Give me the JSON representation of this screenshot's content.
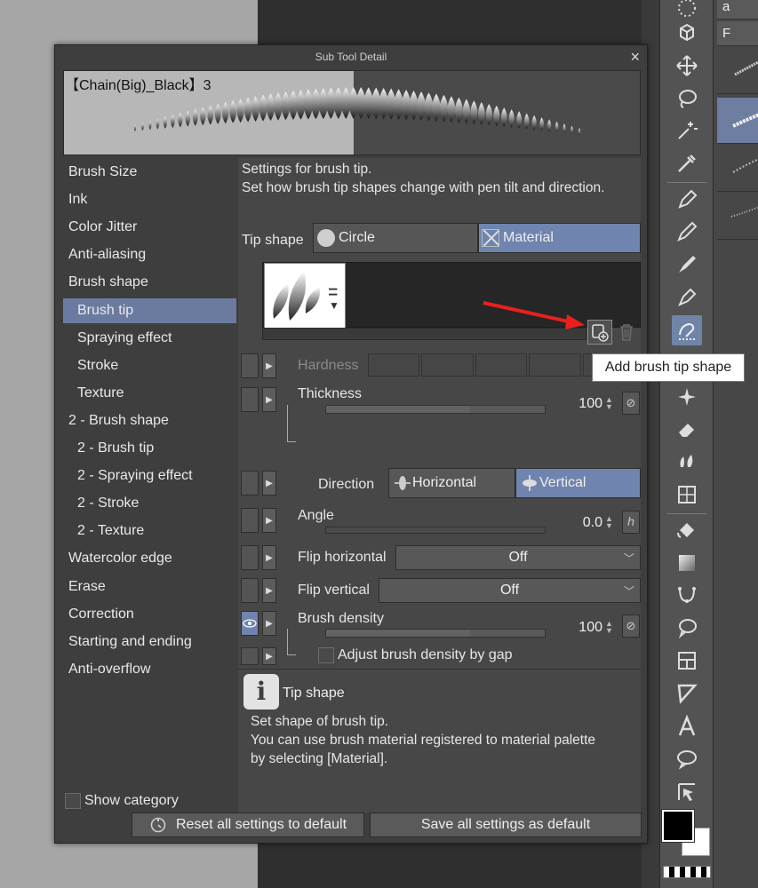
{
  "dialog": {
    "title": "Sub Tool Detail",
    "close_label": "×",
    "preview_name": "【Chain(Big)_Black】3"
  },
  "categories": [
    {
      "label": "Brush Size",
      "sub": false
    },
    {
      "label": "Ink",
      "sub": false
    },
    {
      "label": "Color Jitter",
      "sub": false
    },
    {
      "label": "Anti-aliasing",
      "sub": false
    },
    {
      "label": "Brush shape",
      "sub": false
    },
    {
      "label": "Brush tip",
      "sub": true,
      "active": true
    },
    {
      "label": "Spraying effect",
      "sub": true
    },
    {
      "label": "Stroke",
      "sub": true
    },
    {
      "label": "Texture",
      "sub": true
    },
    {
      "label": "2 - Brush shape",
      "sub": false
    },
    {
      "label": "2 - Brush tip",
      "sub": true
    },
    {
      "label": "2 - Spraying effect",
      "sub": true
    },
    {
      "label": "2 - Stroke",
      "sub": true
    },
    {
      "label": "2 - Texture",
      "sub": true
    },
    {
      "label": "Watercolor edge",
      "sub": false
    },
    {
      "label": "Erase",
      "sub": false
    },
    {
      "label": "Correction",
      "sub": false
    },
    {
      "label": "Starting and ending",
      "sub": false
    },
    {
      "label": "Anti-overflow",
      "sub": false
    }
  ],
  "show_category_label": "Show category",
  "settings": {
    "intro_line1": "Settings for brush tip.",
    "intro_line2": "Set how brush tip shapes change with pen tilt and direction.",
    "tip_shape_label": "Tip shape",
    "tip_shape_options": [
      "Circle",
      "Material"
    ],
    "tip_shape_selected": "Material",
    "hardness_label": "Hardness",
    "thickness_label": "Thickness",
    "thickness_value": "100",
    "direction_label": "Direction",
    "direction_options": [
      "Horizontal",
      "Vertical"
    ],
    "direction_selected": "Vertical",
    "angle_label": "Angle",
    "angle_value": "0.0",
    "flip_h_label": "Flip horizontal",
    "flip_h_value": "Off",
    "flip_v_label": "Flip vertical",
    "flip_v_value": "Off",
    "density_label": "Brush density",
    "density_value": "100",
    "adjust_density_label": "Adjust brush density by gap"
  },
  "info": {
    "icon": "i",
    "title": "Tip shape",
    "body_line1": "Set shape of brush tip.",
    "body_line2": "You can use brush material registered to material palette",
    "body_line3": "by selecting [Material]."
  },
  "buttons": {
    "reset_all": "Reset all settings to default",
    "save_all": "Save all settings as default"
  },
  "tooltip": "Add brush tip shape",
  "subtools_top": [
    "a",
    "F"
  ],
  "colors": {
    "accent": "#6f84ae",
    "arrow": "#e8201e"
  }
}
